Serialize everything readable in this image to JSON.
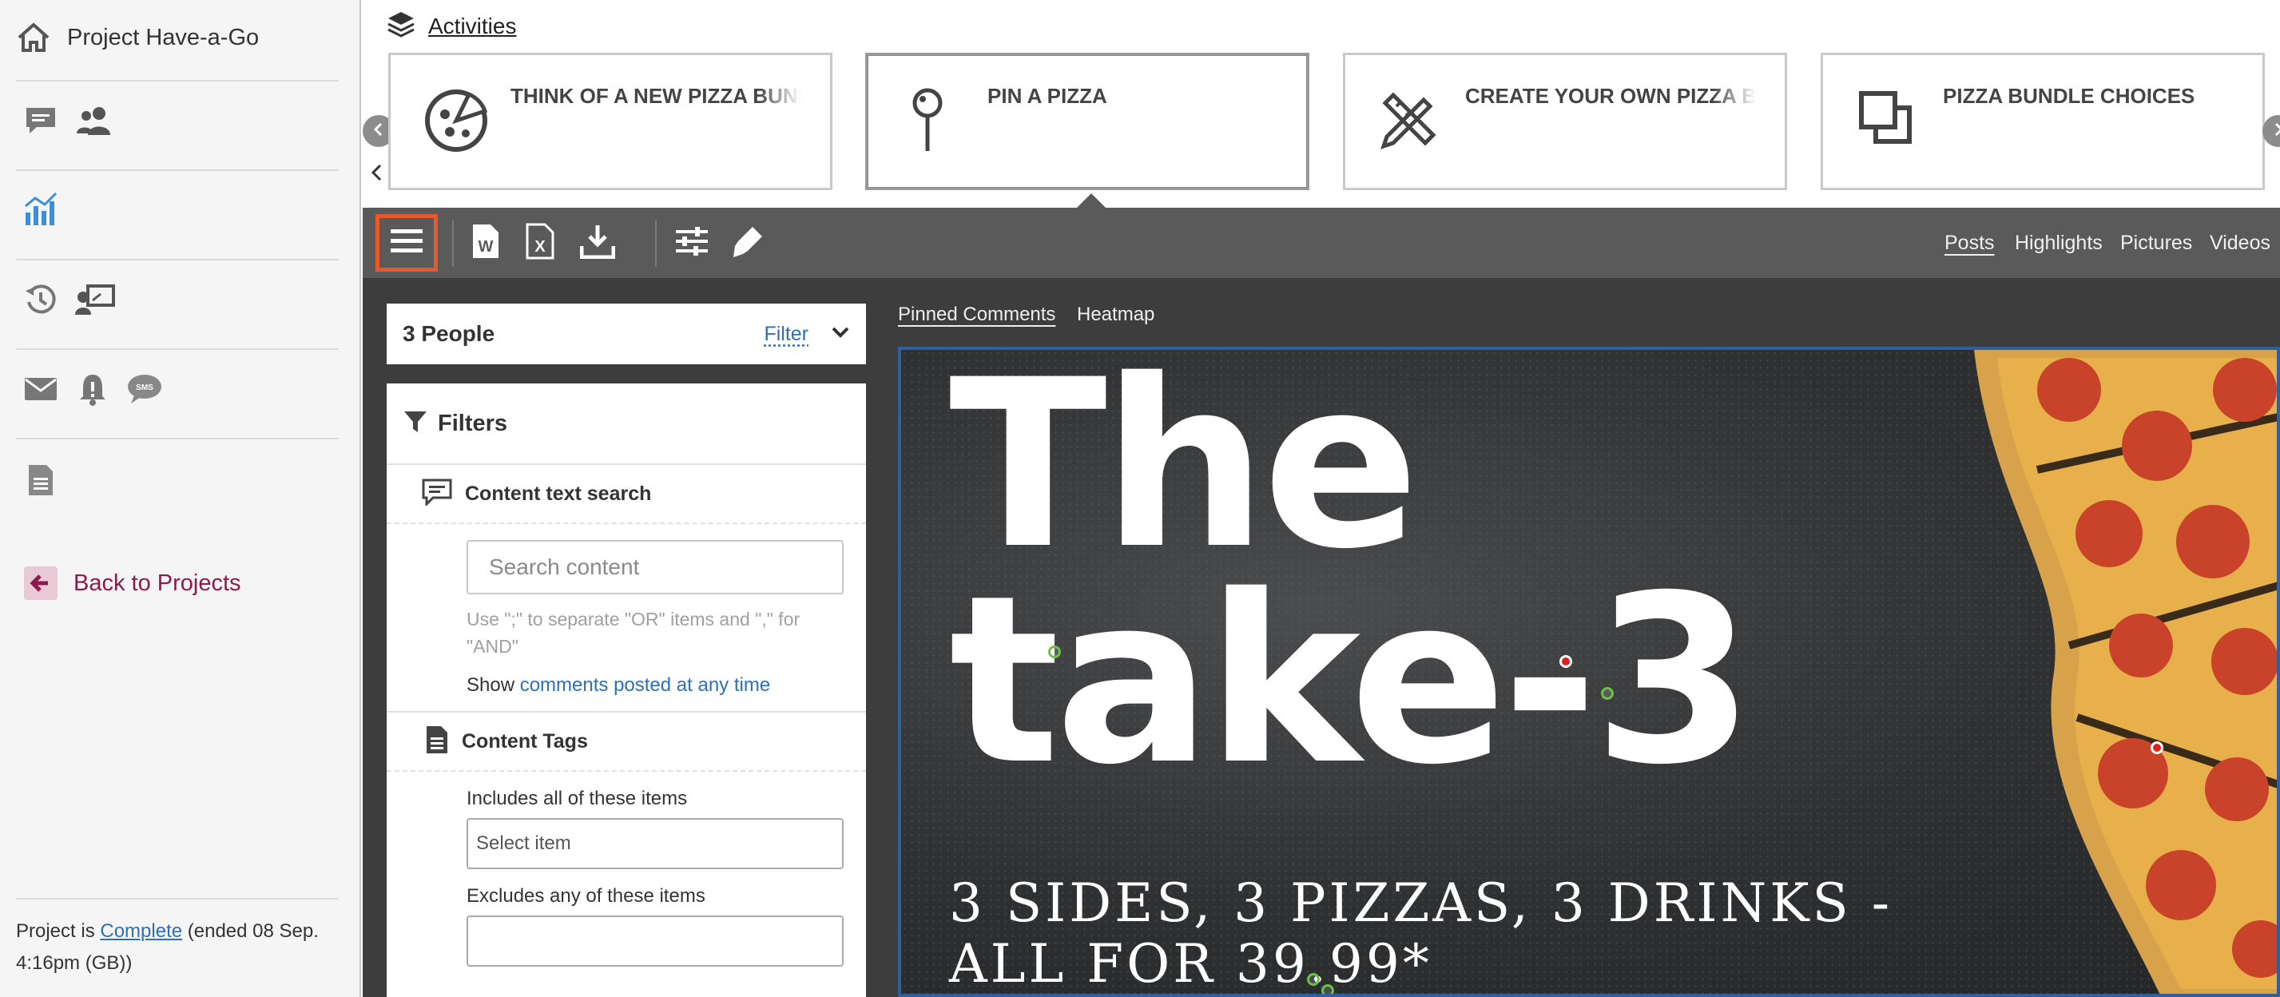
{
  "sidebar": {
    "project_name": "Project Have-a-Go",
    "back_label": "Back to Projects",
    "footer": {
      "prefix": "Project is ",
      "status": "Complete",
      "suffix": " (ended 08 Sep. 4:16pm (GB))"
    }
  },
  "activities": {
    "title": "Activities",
    "cards": [
      {
        "label": "THINK OF A NEW PIZZA BUNDLE",
        "icon": "pizza-slice-icon"
      },
      {
        "label": "PIN A PIZZA",
        "icon": "pin-icon"
      },
      {
        "label": "CREATE YOUR OWN PIZZA BUNDLE",
        "icon": "pencil-ruler-icon"
      },
      {
        "label": "PIZZA BUNDLE CHOICES",
        "icon": "copy-squares-icon"
      }
    ]
  },
  "toolbar": {
    "views": [
      "Posts",
      "Highlights",
      "Pictures",
      "Videos"
    ],
    "active_view": "Posts"
  },
  "people": {
    "count_label": "3 People",
    "filter_link": "Filter"
  },
  "filters": {
    "title": "Filters",
    "content_search": {
      "title": "Content text search",
      "placeholder": "Search content",
      "hint": "Use \";\" to separate \"OR\" items and \",\" for \"AND\"",
      "show_prefix": "Show ",
      "show_link": "comments posted at any time"
    },
    "content_tags": {
      "title": "Content Tags",
      "includes_label": "Includes all of these items",
      "includes_placeholder": "Select item",
      "excludes_label": "Excludes any of these items"
    }
  },
  "image_tabs": {
    "pinned": "Pinned Comments",
    "heatmap": "Heatmap"
  },
  "image": {
    "line1": "The",
    "line2": "take-3",
    "offer1": "3 SIDES, 3 PIZZAS, 3 DRINKS -",
    "offer2": "ALL FOR 39.99*"
  },
  "colors": {
    "highlight_border": "#e8582b",
    "link": "#2e6fb7",
    "back_link": "#8c1a4b",
    "image_frame": "#2f5f9c"
  }
}
